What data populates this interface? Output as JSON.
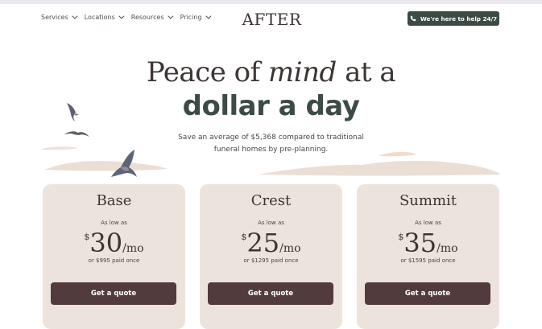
{
  "nav": {
    "items": [
      {
        "label": "Services"
      },
      {
        "label": "Locations"
      },
      {
        "label": "Resources"
      },
      {
        "label": "Pricing"
      }
    ],
    "logo_text": "AFTER",
    "help_label": "We're here to help 24/7"
  },
  "hero": {
    "line1_before": "Peace of ",
    "line1_italic": "mind",
    "line1_after": " at a",
    "line2": "dollar a day",
    "subtitle": "Save an average of $5,368 compared to traditional funeral homes by pre-planning."
  },
  "plans": [
    {
      "name": "Base",
      "as_low_as": "As low as",
      "currency": "$",
      "amount": "30",
      "per": "/mo",
      "once": "or $995 paid once",
      "cta": "Get a quote"
    },
    {
      "name": "Crest",
      "as_low_as": "As low as",
      "currency": "$",
      "amount": "25",
      "per": "/mo",
      "once": "or $1295 paid once",
      "cta": "Get a quote"
    },
    {
      "name": "Summit",
      "as_low_as": "As low as",
      "currency": "$",
      "amount": "35",
      "per": "/mo",
      "once": "or $1595 paid once",
      "cta": "Get a quote"
    }
  ],
  "colors": {
    "brand_green": "#3c4b44",
    "button_plum": "#523b3c",
    "card_bg": "#ede3dd",
    "text_dark": "#3d3534"
  }
}
